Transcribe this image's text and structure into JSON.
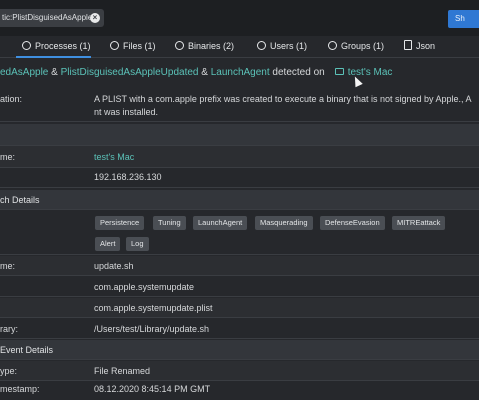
{
  "search": {
    "chip_text": "tic:PlistDisguisedAsApple",
    "chip_close": "×",
    "show_button": "Sh"
  },
  "tabs": [
    {
      "label": "Processes (1)",
      "icon": "processes-icon"
    },
    {
      "label": "Files (1)",
      "icon": "files-icon"
    },
    {
      "label": "Binaries (2)",
      "icon": "binaries-icon"
    },
    {
      "label": "Users (1)",
      "icon": "users-icon"
    },
    {
      "label": "Groups (1)",
      "icon": "groups-icon"
    },
    {
      "label": "Json",
      "icon": "json-icon"
    }
  ],
  "headline": {
    "rule1": "edAsApple",
    "amp1": " & ",
    "rule2": "PlistDisguisedAsAppleUpdated",
    "amp2": " & ",
    "rule3": "LaunchAgent",
    "detected_on": "  detected on",
    "host": "test's Mac"
  },
  "description": {
    "label": "ation:",
    "line1": "A PLIST with a com.apple prefix was created to execute a binary that is not signed by Apple., A",
    "line2": "nt was installed."
  },
  "host": {
    "name_label": "me:",
    "name_value": "test's Mac",
    "ip_value": "192.168.236.130"
  },
  "match_section": {
    "title": "ch Details"
  },
  "tags_row1": [
    "Persistence",
    "Tuning",
    "LaunchAgent",
    "Masquerading",
    "DefenseEvasion",
    "MITREattack"
  ],
  "tags_row2": [
    "Alert",
    "Log"
  ],
  "match_rows": [
    {
      "label": "me:",
      "value": "update.sh"
    },
    {
      "label": "",
      "value": "com.apple.systemupdate"
    },
    {
      "label": "",
      "value": "com.apple.systemupdate.plist"
    },
    {
      "label": "rary:",
      "value": "/Users/test/Library/update.sh"
    }
  ],
  "event_section": {
    "title": "Event Details"
  },
  "event_rows": [
    {
      "label": "ype:",
      "value": "File Renamed"
    },
    {
      "label": "mestamp:",
      "value": "08.12.2020 8:45:14 PM GMT"
    }
  ],
  "colors": {
    "accent": "#5bc2b8",
    "primary_button": "#2f78d3",
    "background": "#26282c"
  }
}
